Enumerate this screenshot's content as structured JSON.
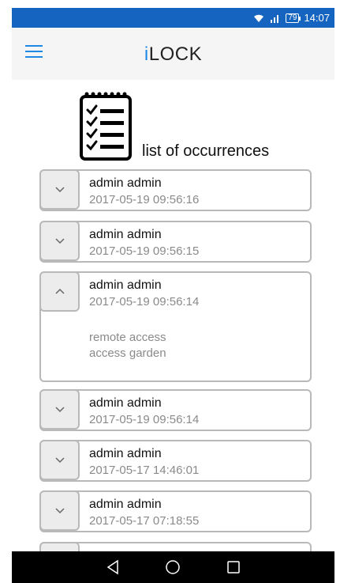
{
  "status_bar": {
    "battery": "79",
    "time": "14:07"
  },
  "app_bar": {
    "title_accent": "i",
    "title_rest": "LOCK"
  },
  "page": {
    "list_title": "list of occurrences"
  },
  "occurrences": [
    {
      "name": "admin admin",
      "time": "2017-05-19 09:56:16",
      "expanded": false
    },
    {
      "name": "admin admin",
      "time": "2017-05-19 09:56:15",
      "expanded": false
    },
    {
      "name": "admin admin",
      "time": "2017-05-19 09:56:14",
      "expanded": true,
      "details": [
        "remote access",
        "access garden"
      ]
    },
    {
      "name": "admin admin",
      "time": "2017-05-19 09:56:14",
      "expanded": false
    },
    {
      "name": "admin admin",
      "time": "2017-05-17 14:46:01",
      "expanded": false
    },
    {
      "name": "admin admin",
      "time": "2017-05-17 07:18:55",
      "expanded": false
    },
    {
      "name": "",
      "time": "",
      "expanded": false
    }
  ],
  "icons": {
    "menu": "menu-icon",
    "checklist": "checklist-icon",
    "chevron_down": "chevron-down-icon",
    "chevron_up": "chevron-up-icon",
    "back": "back-icon",
    "home": "home-icon",
    "recents": "recents-icon"
  },
  "colors": {
    "status_bar": "#1565c0",
    "accent": "#1e88e5",
    "card_border": "#b9b9b9",
    "muted_text": "#8a8a8a"
  }
}
